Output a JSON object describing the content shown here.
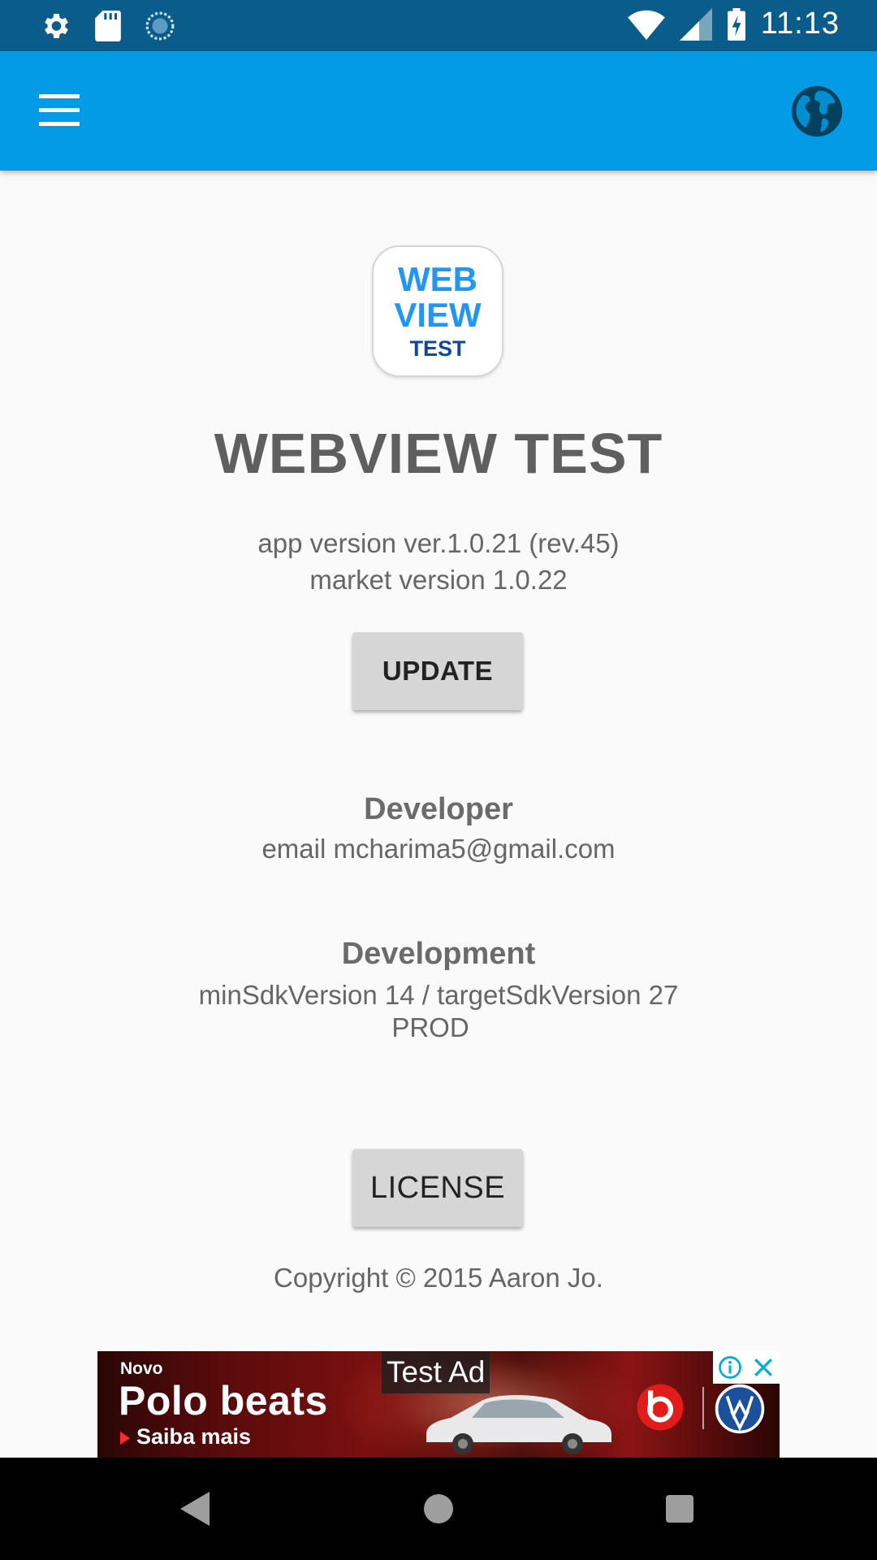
{
  "status_bar": {
    "time": "11:13",
    "icons": [
      "settings-gear-icon",
      "sd-card-icon",
      "loading-spinner-icon",
      "wifi-icon",
      "cell-signal-icon",
      "battery-charging-icon"
    ]
  },
  "app_bar": {
    "menu_icon": "menu-icon",
    "action_icon": "globe-icon",
    "color": "#039be5"
  },
  "logo": {
    "line1": "WEB",
    "line2": "VIEW",
    "line3": "TEST"
  },
  "about": {
    "title": "WEBVIEW TEST",
    "app_version": "app version ver.1.0.21  (rev.45)",
    "market_version": "market version 1.0.22",
    "update_label": "UPDATE",
    "developer_title": "Developer",
    "developer_email": "email  mcharima5@gmail.com",
    "development_title": "Development",
    "sdk_info": "minSdkVersion 14 / targetSdkVersion 27",
    "build_env": "PROD",
    "license_label": "LICENSE",
    "copyright": "Copyright © 2015 Aaron Jo."
  },
  "ad": {
    "badge": "Test Ad",
    "kicker": "Novo",
    "headline": "Polo beats",
    "cta": "Saiba mais"
  },
  "nav_bar": {
    "icons": [
      "back-icon",
      "home-icon",
      "recents-icon"
    ]
  }
}
